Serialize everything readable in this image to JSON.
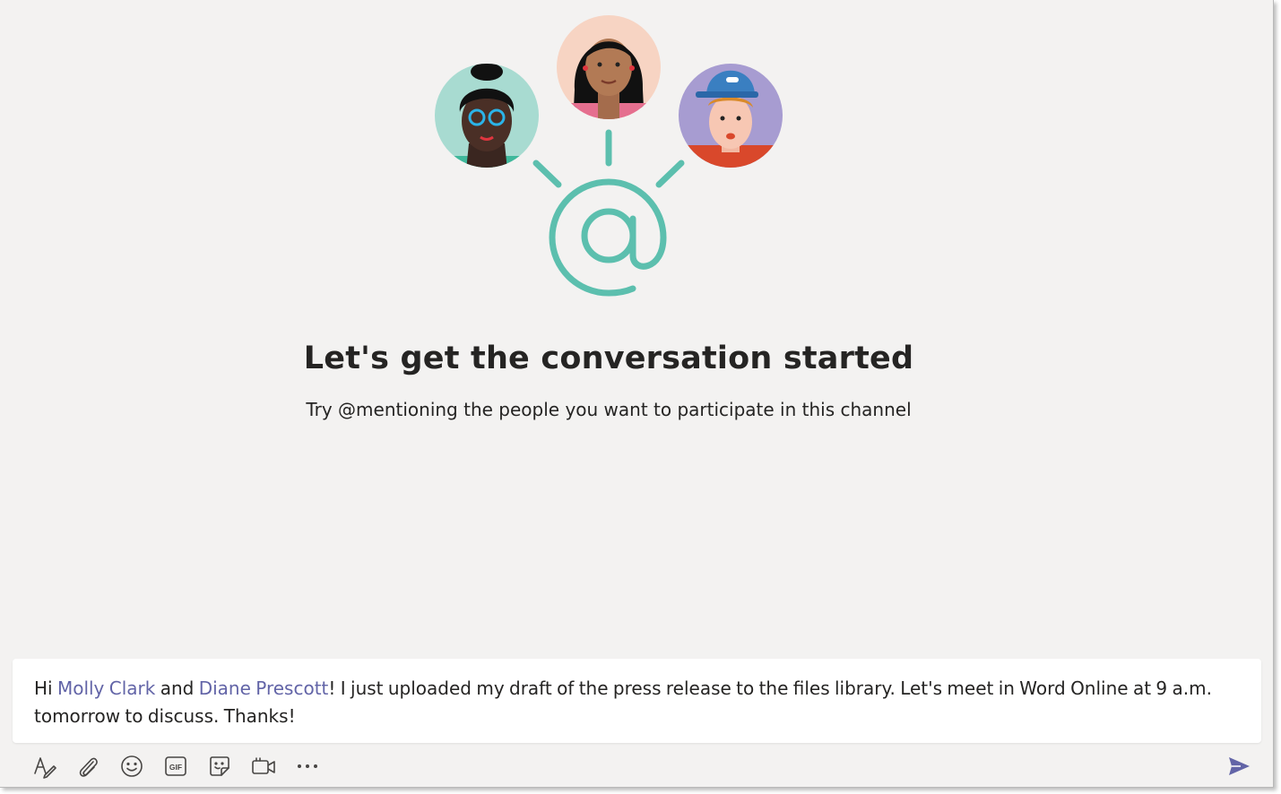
{
  "empty_state": {
    "title": "Let's get the conversation started",
    "subtitle": "Try @mentioning the people you want to participate in this channel"
  },
  "compose": {
    "message_prefix": "Hi ",
    "mention_1": "Molly Clark",
    "message_middle": " and ",
    "mention_2": "Diane Prescott",
    "message_suffix": "! I just uploaded my draft of the press release to the files library. Let's meet in Word Online at 9 a.m. tomorrow to discuss. Thanks!"
  },
  "toolbar": {
    "buttons": [
      "format-icon",
      "attach-icon",
      "emoji-icon",
      "gif-icon",
      "sticker-icon",
      "meet-now-icon",
      "more-options-icon"
    ],
    "gif_label": "GIF",
    "send_icon": "send-icon"
  },
  "colors": {
    "background": "#f3f2f1",
    "accent": "#6264a7",
    "illustration_teal": "#5cbfae"
  }
}
